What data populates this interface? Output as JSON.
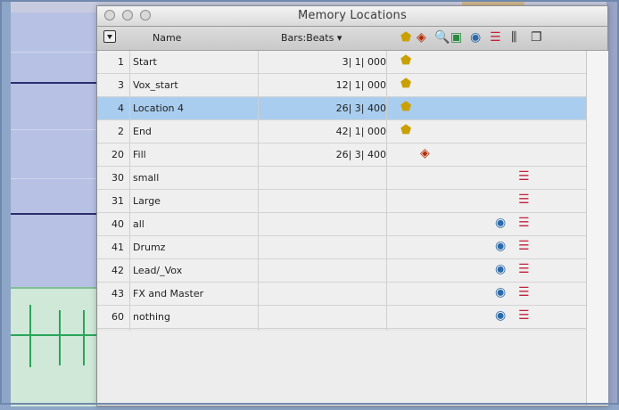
{
  "window": {
    "title": "Memory Locations",
    "header": {
      "menu_icon": "chevron-down-icon",
      "name": "Name",
      "bars_beats": "Bars:Beats ▾",
      "column_icons": [
        "marker-icon",
        "selection-icon",
        "zoom-icon",
        "save-icon",
        "track-height-icon",
        "group-icon",
        "comments-icon",
        "window-icon"
      ]
    },
    "rows": [
      {
        "number": "1",
        "name": "Start",
        "position": "3| 1| 000",
        "icons": [
          "marker"
        ]
      },
      {
        "number": "3",
        "name": "Vox_start",
        "position": "12| 1| 000",
        "icons": [
          "marker"
        ]
      },
      {
        "number": "4",
        "name": "Location 4",
        "position": "26| 3| 400",
        "icons": [
          "marker"
        ]
      },
      {
        "number": "2",
        "name": "End",
        "position": "42| 1| 000",
        "icons": [
          "marker"
        ]
      },
      {
        "number": "20",
        "name": "Fill",
        "position": "26| 3| 400",
        "icons": [
          "selection"
        ]
      },
      {
        "number": "30",
        "name": "small",
        "position": "",
        "icons": [
          "window"
        ]
      },
      {
        "number": "31",
        "name": "Large",
        "position": "",
        "icons": [
          "window"
        ]
      },
      {
        "number": "40",
        "name": "all",
        "position": "",
        "icons": [
          "camera",
          "window"
        ]
      },
      {
        "number": "41",
        "name": "Drumz",
        "position": "",
        "icons": [
          "camera",
          "window"
        ]
      },
      {
        "number": "42",
        "name": "Lead/_Vox",
        "position": "",
        "icons": [
          "camera",
          "window"
        ]
      },
      {
        "number": "43",
        "name": "FX and Master",
        "position": "",
        "icons": [
          "camera",
          "window"
        ]
      },
      {
        "number": "60",
        "name": "nothing",
        "position": "",
        "icons": [
          "camera",
          "window"
        ]
      }
    ],
    "selected_row_index": 2
  }
}
